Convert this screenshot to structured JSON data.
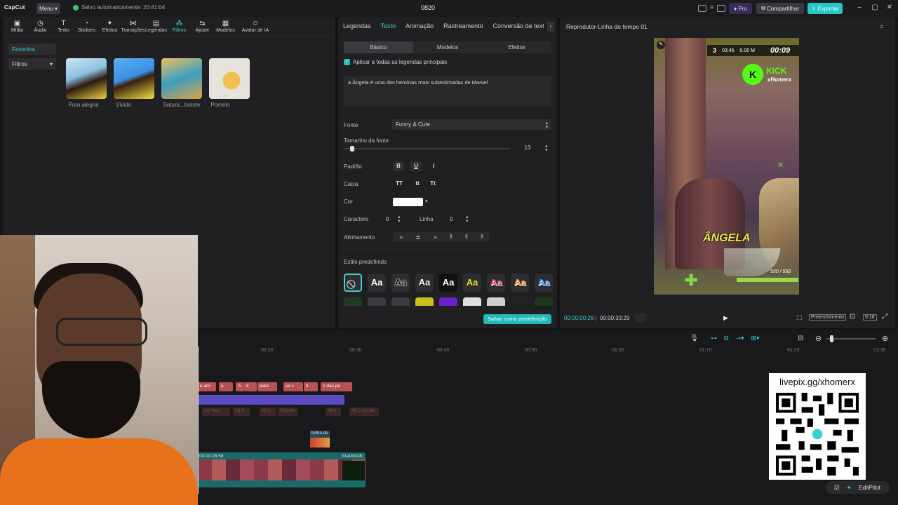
{
  "titlebar": {
    "logo": "CapCut",
    "menu_label": "Menu",
    "autosave": "Salvo automaticamente: 20:41:04",
    "project_title": "0820",
    "pro_label": "Pro",
    "share_label": "Compartilhar",
    "export_label": "Exportar"
  },
  "media_tabs": [
    {
      "label": "Mídia",
      "icon": "media-icon"
    },
    {
      "label": "Áudio",
      "icon": "audio-icon"
    },
    {
      "label": "Texto",
      "icon": "text-icon"
    },
    {
      "label": "Stickers",
      "icon": "sticker-icon"
    },
    {
      "label": "Efeitos",
      "icon": "effects-icon"
    },
    {
      "label": "Transições",
      "icon": "transitions-icon"
    },
    {
      "label": "Legendas",
      "icon": "captions-icon"
    },
    {
      "label": "Filtros",
      "icon": "filters-icon"
    },
    {
      "label": "Ajuste",
      "icon": "adjust-icon"
    },
    {
      "label": "Modelos",
      "icon": "templates-icon"
    },
    {
      "label": "Avatar de IA",
      "icon": "avatar-icon"
    }
  ],
  "sidebar": {
    "favorites": "Favoritos",
    "filters": "Filtros"
  },
  "filters": [
    {
      "name": "Pura alegria"
    },
    {
      "name": "Vívido"
    },
    {
      "name": "Satura...brante"
    },
    {
      "name": "Pomelo"
    }
  ],
  "text_panel": {
    "tabs": [
      "Legendas",
      "Texto",
      "Animação",
      "Rastreamento",
      "Conversão de texto"
    ],
    "active_tab": "Texto",
    "subtabs": [
      "Básico",
      "Modelos",
      "Efeitos"
    ],
    "apply_all": "Aplicar a todas as legendas principais",
    "caption_text": "a Ângela é uma das heroínas mais subestimadas de Marvel",
    "font_label": "Fonte",
    "font_value": "Funny & Cute",
    "size_label": "Tamanho da fonte",
    "size_value": "13",
    "size_fraction": 0.04,
    "pattern_label": "Padrão",
    "case_label": "Caixa",
    "case_options": [
      "TT",
      "tt",
      "Tt"
    ],
    "color_label": "Cor",
    "char_label": "Caractere",
    "char_value": "0",
    "line_label": "Linha",
    "line_value": "0",
    "align_label": "Alinhamento",
    "preset_label": "Estilo predefinido",
    "presets_sample": "Aa",
    "save_preset": "Salvar como predefinição"
  },
  "player": {
    "title": "Reprodutor-Linha do tempo 01",
    "current_time": "00:00:00:26",
    "total_time": "00:00:33:29",
    "fill_label": "Preenchimento",
    "ratio_label": "9:16",
    "video": {
      "hud_num": "3",
      "hud_time_small": "03:45",
      "hud_score": "0.00 M",
      "hud_timer": "00:09",
      "kick_logo": "K",
      "kick_text": "KICK",
      "kick_user": "xHomerx",
      "caption": "ÂNGELA",
      "hp_text": "550 / 550"
    }
  },
  "timeline": {
    "ticks": [
      "00:20",
      "00:30",
      "00:40",
      "00:50",
      "01:00",
      "01:10",
      "01:20",
      "01:30"
    ],
    "text_clips": [
      "e am",
      "é",
      "A",
      "é",
      "para",
      "se v",
      "ti",
      "1 das pe"
    ],
    "faded_clips": [
      "A§ mais",
      "A§ G",
      "A§ é",
      "A§ para",
      "A§ e",
      "A§ 1 das pe"
    ],
    "sticker_label": "bolha-de",
    "clip_time1": "00:00:28:58",
    "clip_time2": "01a00d28:"
  },
  "overlay": {
    "qr_text": "livepix.gg/xhomerx",
    "editpilot": "EditPilot"
  },
  "colors": {
    "accent": "#3ad0d0",
    "export_bg": "#22c7c7",
    "kick_green": "#53fc18",
    "caption_yellow": "#f5e24a"
  }
}
